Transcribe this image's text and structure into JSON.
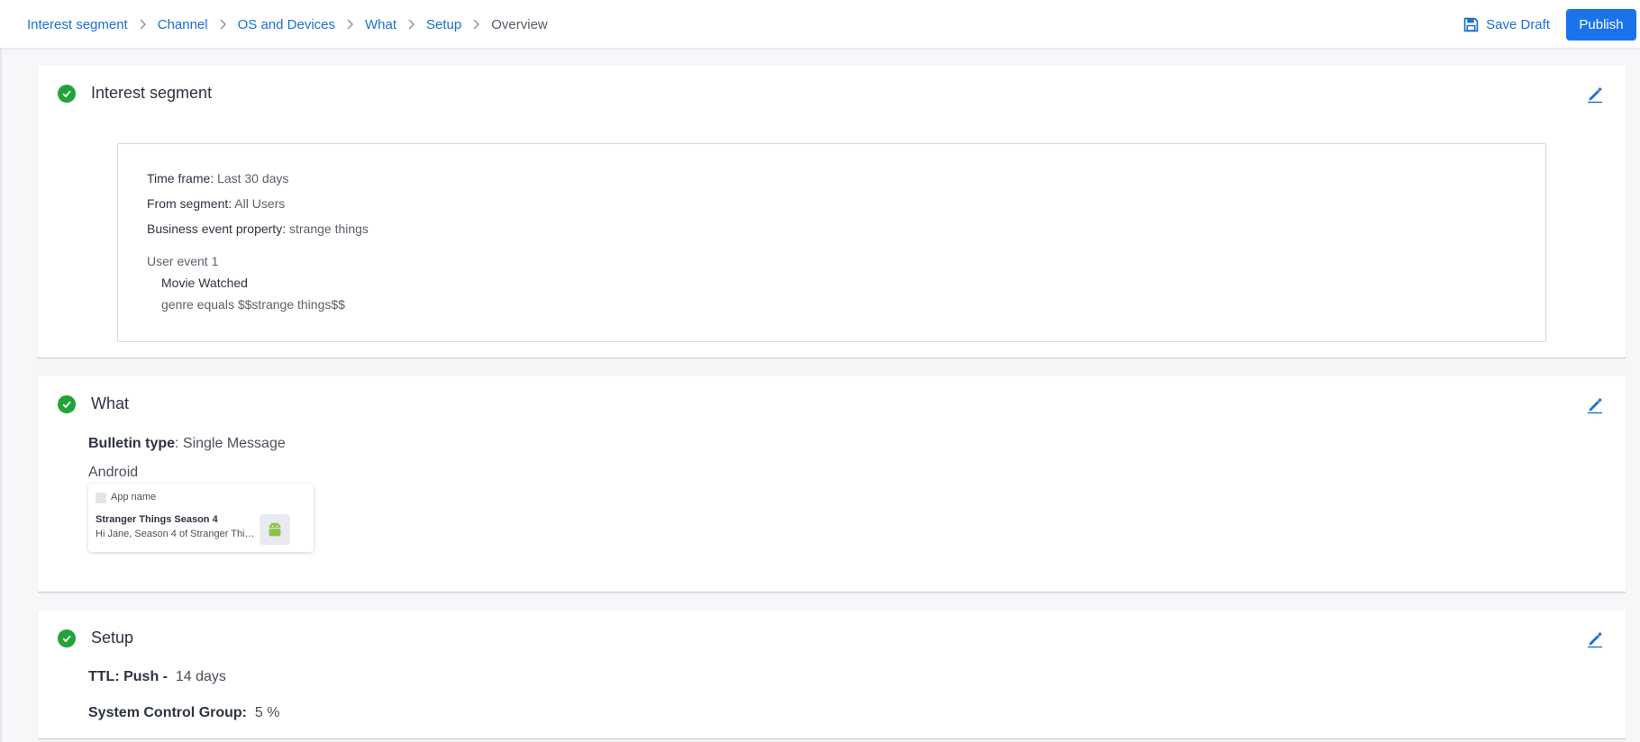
{
  "breadcrumb": {
    "items": [
      "Interest segment",
      "Channel",
      "OS and Devices",
      "What",
      "Setup"
    ],
    "current": "Overview"
  },
  "toolbar": {
    "save_draft_label": "Save Draft",
    "publish_label": "Publish"
  },
  "colors": {
    "accent": "#1a73e8",
    "link": "#1a6fd8",
    "success": "#22a33a"
  },
  "interest_segment": {
    "title": "Interest segment",
    "time_frame_label": "Time frame:",
    "time_frame_value": "Last 30 days",
    "from_segment_label": "From segment:",
    "from_segment_value": "All Users",
    "business_event_label": "Business event property:",
    "business_event_value": "strange things",
    "user_event_label": "User event 1",
    "event_name": "Movie Watched",
    "event_condition": "genre equals $$strange things$$"
  },
  "what": {
    "title": "What",
    "bulletin_type_label": "Bulletin type",
    "bulletin_type_value": ": Single Message",
    "platform": "Android",
    "preview": {
      "app_name": "App name",
      "title": "Stranger Things Season 4",
      "body": "Hi Jane, Season 4 of Stranger Things is now streaming"
    }
  },
  "setup": {
    "title": "Setup",
    "ttl_label": "TTL: Push -",
    "ttl_value": "14 days",
    "control_group_label": "System Control Group:",
    "control_group_value": "5 %"
  },
  "icons": {
    "check": "check-circle-icon",
    "edit": "pencil-edit-icon",
    "save": "floppy-disk-icon",
    "chevron": "chevron-right-icon",
    "android": "android-icon"
  }
}
